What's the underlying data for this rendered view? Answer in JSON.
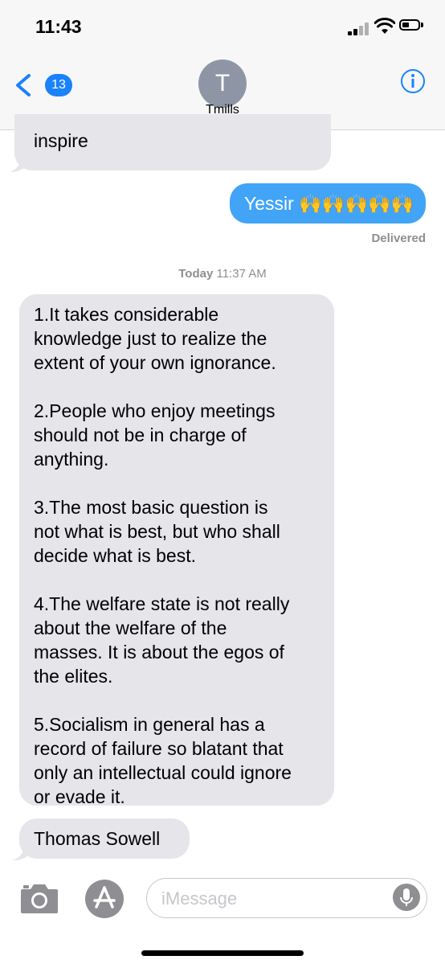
{
  "status": {
    "time": "11:43"
  },
  "nav": {
    "badge_count": "13",
    "avatar_initial": "T",
    "contact_name": "Tmills",
    "back_icon": "chevron-left-icon",
    "info_icon": "info-icon"
  },
  "thread": {
    "messages": [
      {
        "from": "them",
        "text": "inspire"
      },
      {
        "from": "me",
        "text": "Yessir 🙌🙌🙌🙌🙌"
      },
      {
        "from": "them",
        "text": "1.It takes considerable\nknowledge just to realize the\nextent of your own ignorance.\n\n2.People who enjoy meetings\nshould not be in charge of\nanything.\n\n3.The most basic question is\nnot what is best, but who shall\ndecide what is best.\n\n4.The welfare state is not really\nabout the welfare of the\nmasses. It is about the egos of\nthe elites.\n\n5.Socialism in general has a\nrecord of failure so blatant that\nonly an intellectual could ignore\nor evade it."
      },
      {
        "from": "them",
        "text": "Thomas Sowell"
      }
    ],
    "delivered_label": "Delivered",
    "timestamp_day": "Today",
    "timestamp_time": "11:37 AM"
  },
  "input": {
    "placeholder": "iMessage",
    "camera_icon": "camera-icon",
    "apps_icon": "app-store-icon",
    "mic_icon": "microphone-icon"
  },
  "colors": {
    "accent": "#1a82fb",
    "outgoing_bubble": "#41a4f7",
    "incoming_bubble": "#e5e5ea"
  }
}
